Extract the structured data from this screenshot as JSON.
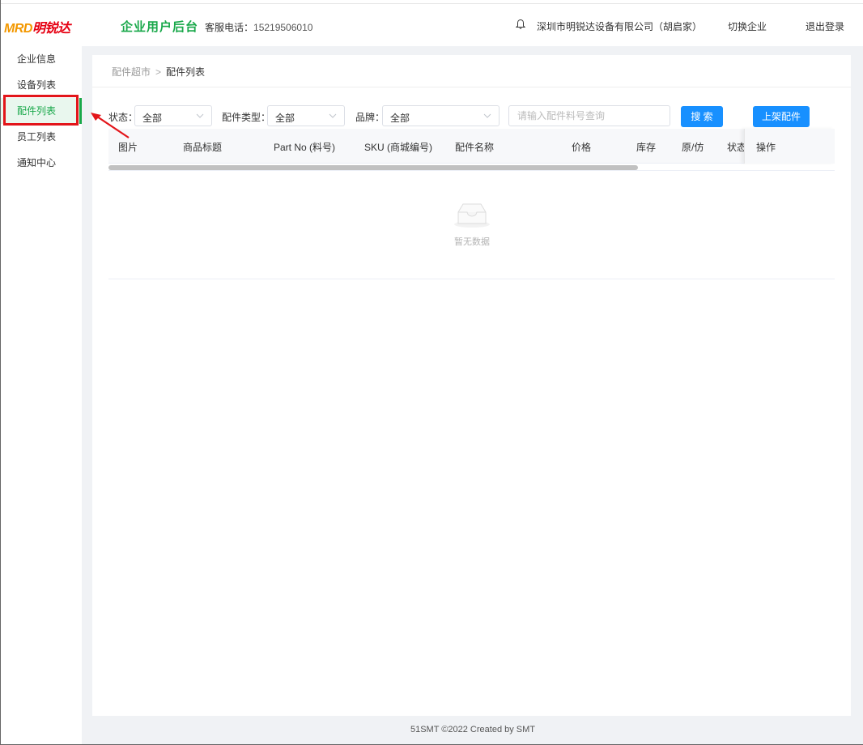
{
  "header": {
    "logo_latin": "MRD",
    "logo_cn": "明锐达",
    "app_title": "企业用户后台",
    "hotline_label": "客服电话：",
    "hotline_number": "15219506010",
    "company": "深圳市明锐达设备有限公司（胡启家）",
    "switch_label": "切换企业",
    "logout_label": "退出登录"
  },
  "sidebar": {
    "items": [
      {
        "label": "企业信息"
      },
      {
        "label": "设备列表"
      },
      {
        "label": "配件列表"
      },
      {
        "label": "员工列表"
      },
      {
        "label": "通知中心"
      }
    ],
    "active_index": 2
  },
  "breadcrumb": {
    "parent": "配件超市",
    "separator": ">",
    "current": "配件列表"
  },
  "filters": {
    "status_label": "状态：",
    "status_value": "全部",
    "type_label": "配件类型：",
    "type_value": "全部",
    "brand_label": "品牌：",
    "brand_value": "全部",
    "search_placeholder": "请输入配件料号查询",
    "search_button": "搜 索",
    "publish_button": "上架配件"
  },
  "table": {
    "columns": [
      "图片",
      "商品标题",
      "Part No (料号)",
      "SKU (商城编号)",
      "配件名称",
      "价格",
      "库存",
      "原/仿",
      "状态"
    ],
    "fixed_column": "操作",
    "empty_text": "暂无数据",
    "rows": []
  },
  "footer": {
    "text": "51SMT ©2022 Created by SMT"
  },
  "colors": {
    "brand_green": "#19a84a",
    "primary_blue": "#1890ff",
    "highlight_red": "#e3151a",
    "logo_orange": "#f39800"
  }
}
